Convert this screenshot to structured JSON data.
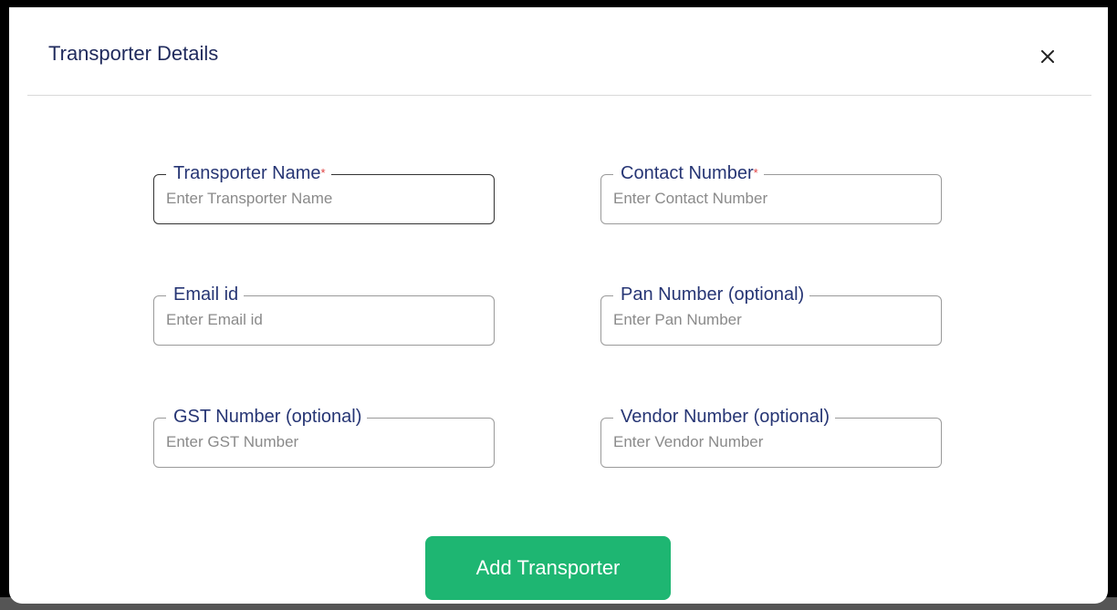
{
  "modal": {
    "title": "Transporter Details",
    "close_icon": "close-icon",
    "submit_label": "Add Transporter"
  },
  "fields": [
    {
      "label": "Transporter Name",
      "required_mark": "*",
      "placeholder": "Enter Transporter Name",
      "value": ""
    },
    {
      "label": "Contact Number",
      "required_mark": "*",
      "placeholder": "Enter Contact Number",
      "value": ""
    },
    {
      "label": "Email id",
      "required_mark": "",
      "placeholder": "Enter Email id",
      "value": ""
    },
    {
      "label": "Pan Number (optional)",
      "required_mark": "",
      "placeholder": "Enter Pan Number",
      "value": ""
    },
    {
      "label": "GST Number (optional)",
      "required_mark": "",
      "placeholder": "Enter GST Number",
      "value": ""
    },
    {
      "label": "Vendor Number (optional)",
      "required_mark": "",
      "placeholder": "Enter Vendor Number",
      "value": ""
    }
  ],
  "colors": {
    "title": "#1f2a5c",
    "label": "#263574",
    "required": "#e04040",
    "button": "#1eb672"
  }
}
